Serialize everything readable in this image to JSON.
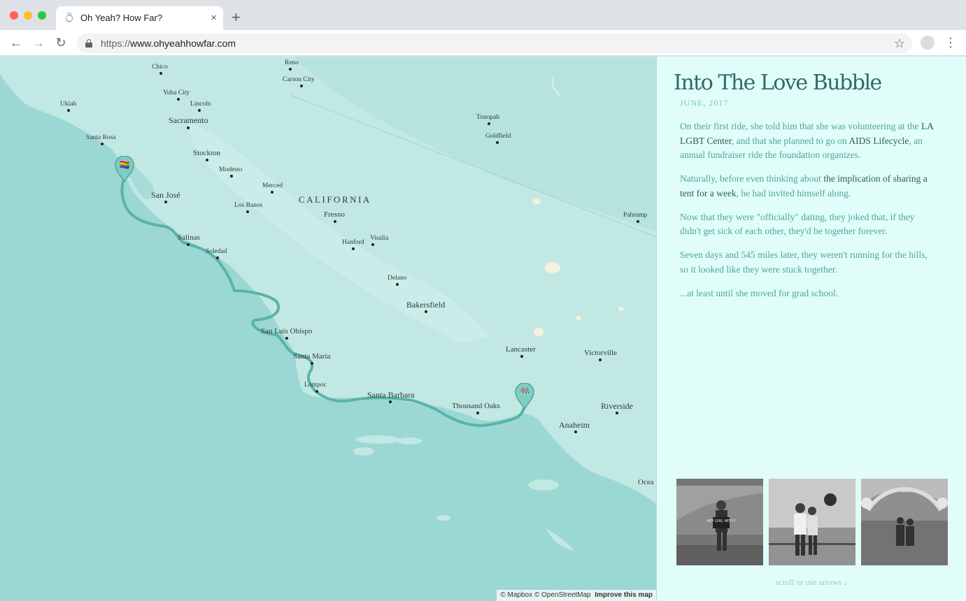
{
  "browser": {
    "tab_title": "Oh Yeah? How Far?",
    "tab_favicon": "ring-icon",
    "url_scheme": "https://",
    "url_host": "www.ohyeahhowfar.com",
    "new_tab": "+",
    "close": "×"
  },
  "map": {
    "state_label": "CALIFORNIA",
    "cities": [
      {
        "name": "Chico"
      },
      {
        "name": "Reno"
      },
      {
        "name": "Carson City"
      },
      {
        "name": "Yuba City"
      },
      {
        "name": "Ukiah"
      },
      {
        "name": "Lincoln"
      },
      {
        "name": "Sacramento"
      },
      {
        "name": "Tonopah"
      },
      {
        "name": "Goldfield"
      },
      {
        "name": "Santa Rosa"
      },
      {
        "name": "Stockton"
      },
      {
        "name": "Modesto"
      },
      {
        "name": "San José"
      },
      {
        "name": "Merced"
      },
      {
        "name": "Los Banos"
      },
      {
        "name": "Fresno"
      },
      {
        "name": "Pahrump"
      },
      {
        "name": "Salinas"
      },
      {
        "name": "Soledad"
      },
      {
        "name": "Hanford"
      },
      {
        "name": "Visalia"
      },
      {
        "name": "Delano"
      },
      {
        "name": "Bakersfield"
      },
      {
        "name": "San Luis Obispo"
      },
      {
        "name": "Lancaster"
      },
      {
        "name": "Victorville"
      },
      {
        "name": "Santa Maria"
      },
      {
        "name": "Lompoc"
      },
      {
        "name": "Santa Barbara"
      },
      {
        "name": "Thousand Oaks"
      },
      {
        "name": "Riverside"
      },
      {
        "name": "Anaheim"
      },
      {
        "name": "Ocea"
      }
    ],
    "start_marker": "rainbow-flag-icon",
    "end_marker": "checkered-flag-icon",
    "attribution": "© Mapbox © OpenStreetMap",
    "improve_link": "Improve this map"
  },
  "story": {
    "title": "Into The Love Bubble",
    "date": "JUNE, 2017",
    "p1_a": "On their first ride, she told him that she was volunteering at the ",
    "p1_link1": "LA LGBT Center",
    "p1_b": ", and that she planned to go on ",
    "p1_link2": "AIDS Lifecycle",
    "p1_c": ", an annual fundraiser ride the foundation organizes.",
    "p2_a": "Naturally, before even thinking about ",
    "p2_em": "the implication of sharing a tent for a week",
    "p2_b": ", he had invited himself along.",
    "p3": "Now that they were \"officially\" dating, they joked that, if they didn't get sick of each other, they'd be together forever.",
    "p4": "Seven days and 545 miles later, they weren't running for the hills, so it looked like they were stuck together.",
    "p5": "...at least until she moved for grad school.",
    "photo_sign_text": "HEY GIRL HEYYY",
    "scroll_hint": "scroll or use arrows ↓"
  }
}
